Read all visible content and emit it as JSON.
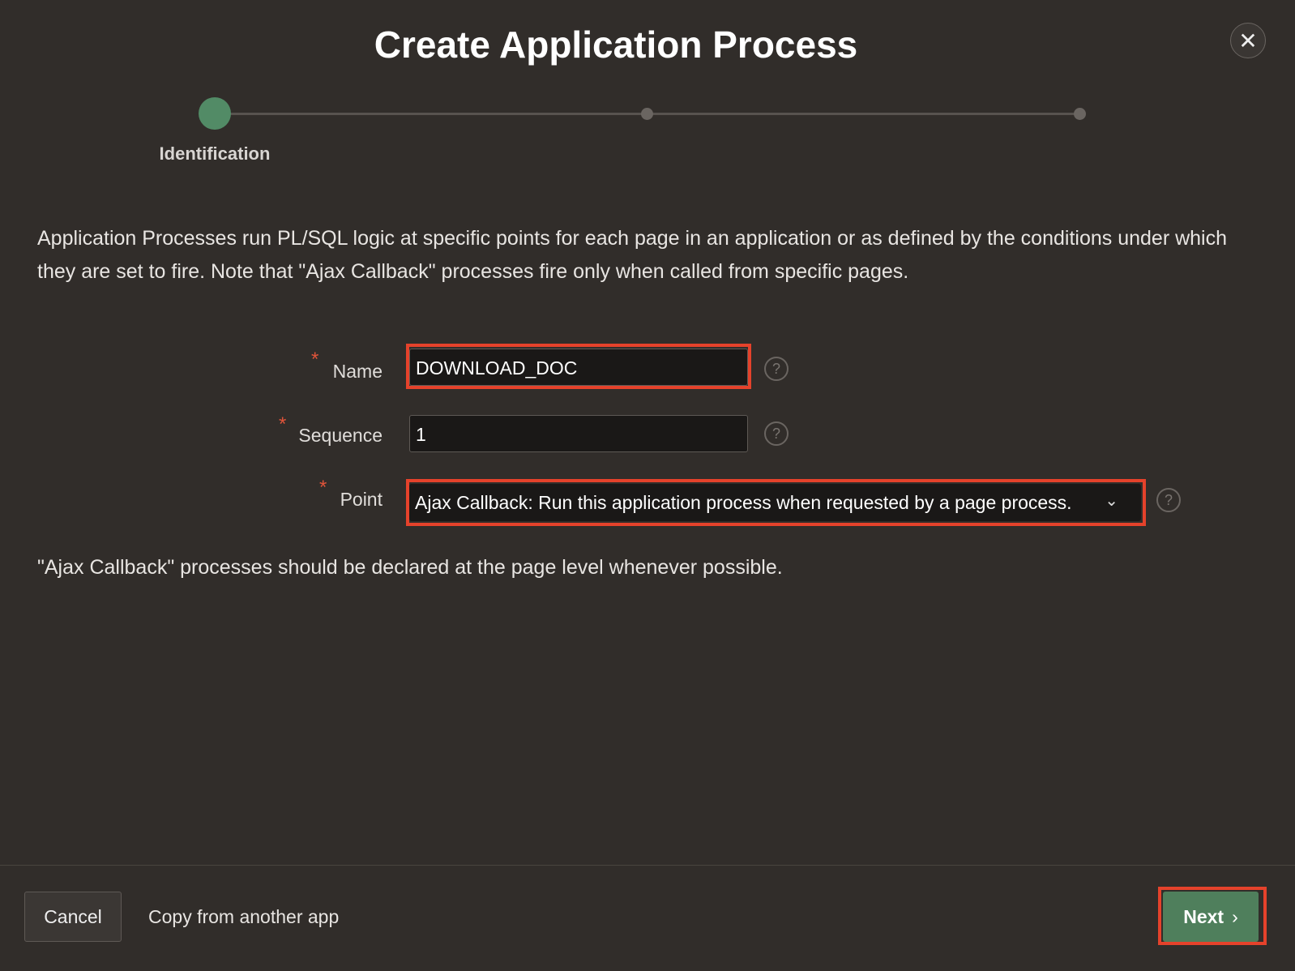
{
  "dialog": {
    "title": "Create Application Process",
    "close_icon": "close-icon"
  },
  "wizard": {
    "steps": [
      {
        "label": "Identification",
        "active": true
      },
      {
        "label": "",
        "active": false
      },
      {
        "label": "",
        "active": false
      }
    ],
    "active_color": "#528b66"
  },
  "description": "Application Processes run PL/SQL logic at specific points for each page in an application or as defined by the conditions under which they are set to fire. Note that \"Ajax Callback\" processes fire only when called from specific pages.",
  "form": {
    "required_marker": "*",
    "name": {
      "label": "Name",
      "value": "DOWNLOAD_DOC"
    },
    "sequence": {
      "label": "Sequence",
      "value": "1"
    },
    "point": {
      "label": "Point",
      "value": "Ajax Callback: Run this application process when requested by a page process."
    },
    "help": "?"
  },
  "note": "\"Ajax Callback\" processes should be declared at the page level whenever possible.",
  "footer": {
    "cancel": "Cancel",
    "copy": "Copy from another app",
    "next": "Next",
    "next_icon": "chevron-right-icon"
  },
  "highlight_color": "#e5422b"
}
